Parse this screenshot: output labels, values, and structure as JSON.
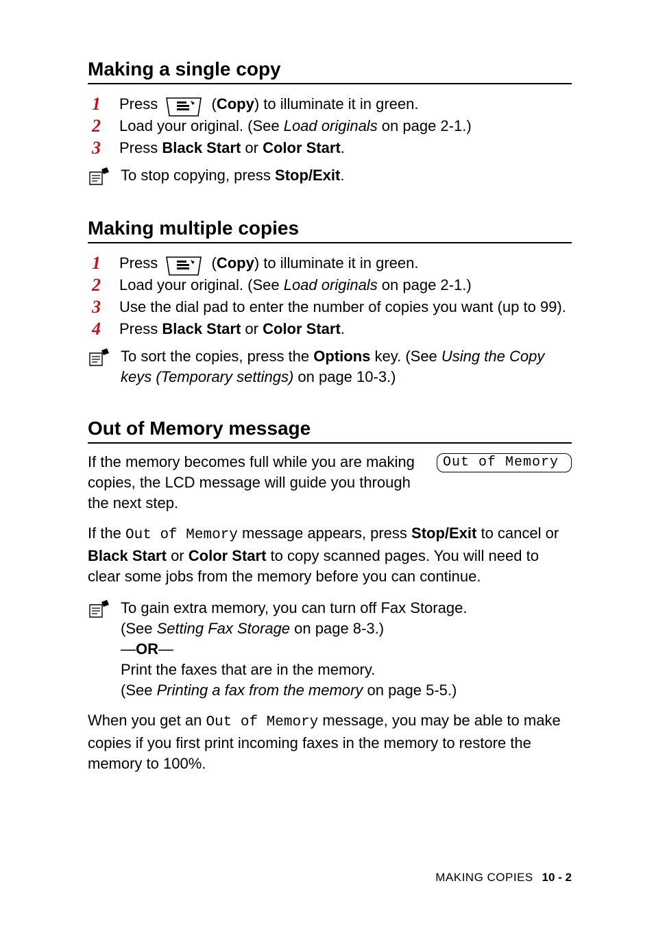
{
  "sections": {
    "single": {
      "heading": "Making a single copy",
      "step1_a": "Press ",
      "step1_b": " (",
      "step1_copy": "Copy",
      "step1_c": ") to illuminate it in green.",
      "step2_a": "Load your original. (See ",
      "step2_ref": "Load originals",
      "step2_b": " on page 2-1.)",
      "step3_a": "Press ",
      "step3_b1": "Black Start",
      "step3_or": " or ",
      "step3_b2": "Color Start",
      "step3_c": ".",
      "note1_a": "To stop copying, press ",
      "note1_b": "Stop/Exit",
      "note1_c": "."
    },
    "multi": {
      "heading": "Making multiple copies",
      "step1_a": "Press ",
      "step1_b": " (",
      "step1_copy": "Copy",
      "step1_c": ") to illuminate it in green.",
      "step2_a": "Load your original. (See ",
      "step2_ref": "Load originals",
      "step2_b": " on page 2-1.)",
      "step3": "Use the dial pad to enter the number of copies you want (up to 99).",
      "step4_a": "Press ",
      "step4_b1": "Black Start",
      "step4_or": " or ",
      "step4_b2": "Color Start",
      "step4_c": ".",
      "note_a": "To sort the copies, press the ",
      "note_opt": "Options",
      "note_b": " key. (See ",
      "note_ref": "Using the Copy keys (Temporary settings)",
      "note_c": " on page 10-3.)"
    },
    "mem": {
      "heading": "Out of Memory message",
      "lcd": "Out of Memory",
      "p1": "If the memory becomes full while you are making copies, the LCD message will guide you through the next step.",
      "p2_a": "If the ",
      "p2_mono": "Out of Memory",
      "p2_b": " message appears, press ",
      "p2_stop": "Stop/Exit",
      "p2_c": " to cancel or ",
      "p2_bs": "Black Start",
      "p2_or": " or ",
      "p2_cs": "Color Start",
      "p2_d": " to copy scanned pages. You will need to clear some jobs from the memory before you can continue.",
      "note_l1": "To gain extra memory, you can turn off Fax Storage.",
      "note_l2_a": "(See ",
      "note_l2_ref": "Setting Fax Storage",
      "note_l2_b": " on page 8-3.)",
      "note_or_a": "—",
      "note_or_b": "OR",
      "note_or_c": "—",
      "note_l3": "Print the faxes that are in the memory.",
      "note_l4_a": "(See ",
      "note_l4_ref": "Printing a fax from the memory",
      "note_l4_b": " on page 5-5.)",
      "p3_a": "When you get an ",
      "p3_mono": "Out of Memory",
      "p3_b": " message, you may be able to make copies if you first print incoming faxes in the memory to restore the memory to 100%."
    }
  },
  "nums": {
    "n1": "1",
    "n2": "2",
    "n3": "3",
    "n4": "4"
  },
  "footer": {
    "chapter": "MAKING COPIES",
    "page": "10 - 2"
  }
}
